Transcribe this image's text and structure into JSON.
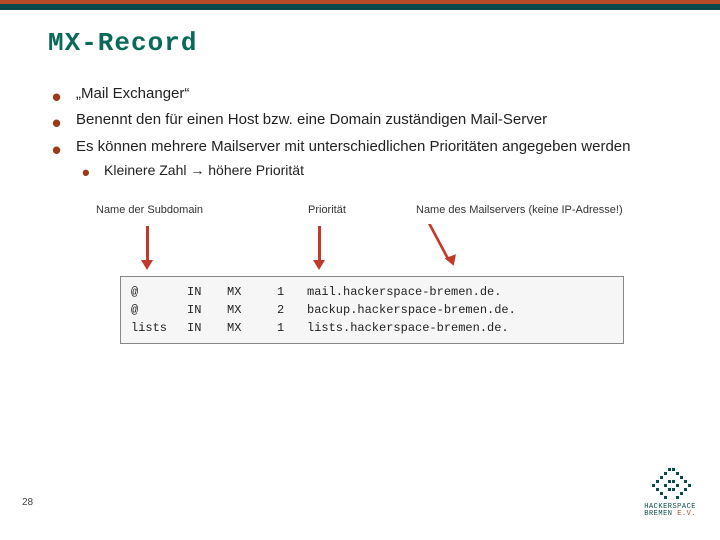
{
  "title": "MX-Record",
  "bullets": {
    "b1": "„Mail Exchanger“",
    "b2": "Benennt den für einen Host bzw. eine Domain zuständigen Mail-Server",
    "b3": "Es können mehrere Mailserver mit unterschiedlichen Prioritäten angegeben werden",
    "sub1": "Kleinere Zahl → höhere Priorität"
  },
  "annotations": {
    "name": "Name der Subdomain",
    "prio": "Priorität",
    "target": "Name des Mailservers (keine IP-Adresse!)"
  },
  "records": [
    {
      "name": "@",
      "class": "IN",
      "type": "MX",
      "prio": "1",
      "target": "mail.hackerspace-bremen.de."
    },
    {
      "name": "@",
      "class": "IN",
      "type": "MX",
      "prio": "2",
      "target": "backup.hackerspace-bremen.de."
    },
    {
      "name": "lists",
      "class": "IN",
      "type": "MX",
      "prio": "1",
      "target": "lists.hackerspace-bremen.de."
    }
  ],
  "page_number": "28",
  "logo": {
    "line1": "HACKERSPACE",
    "line2": "BREMEN",
    "suffix": "E.V."
  }
}
